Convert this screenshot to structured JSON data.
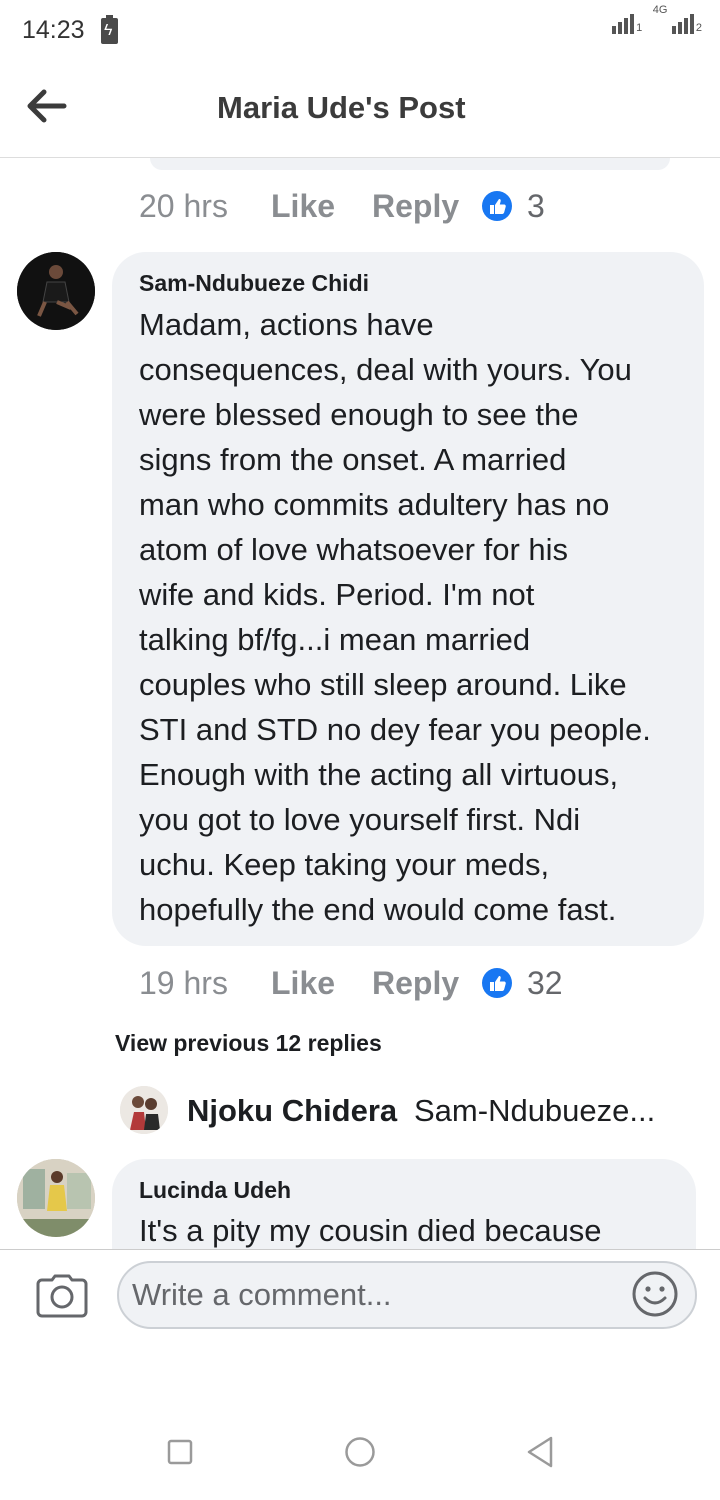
{
  "status_bar": {
    "time": "14:23",
    "network": "4G",
    "sim1": "1",
    "sim2": "2"
  },
  "header": {
    "title": "Maria Ude's Post"
  },
  "prev_comment_actions": {
    "time": "20 hrs",
    "like_label": "Like",
    "reply_label": "Reply",
    "reaction_count": "3"
  },
  "comments": [
    {
      "author": "Sam-Ndubueze Chidi",
      "lines": [
        "Madam, actions have",
        "consequences, deal with yours. You",
        "were blessed enough to see the",
        "signs from the onset. A married",
        "man who commits adultery has no",
        "atom of love whatsoever for his",
        "wife and kids. Period. I'm not",
        "talking bf/fg...i mean married",
        "couples who still sleep around. Like",
        "STI and STD no dey fear you people.",
        "Enough with the acting all virtuous,",
        "you got to love yourself first. Ndi",
        "uchu. Keep taking your meds,",
        "hopefully the end would come fast."
      ],
      "time": "19 hrs",
      "like_label": "Like",
      "reply_label": "Reply",
      "reaction_count": "32",
      "view_previous": "View previous 12 replies",
      "latest_reply": {
        "author": "Njoku Chidera",
        "preview": "Sam-Ndubueze..."
      }
    },
    {
      "author": "Lucinda Udeh",
      "lines": [
        "It's a pity my cousin died because"
      ]
    }
  ],
  "composer": {
    "placeholder": "Write a comment..."
  },
  "icons": {
    "back": "arrow-left-icon",
    "camera": "camera-icon",
    "emoji": "smiley-icon",
    "like": "thumbs-up-icon",
    "nav": [
      "square-recents-icon",
      "circle-home-icon",
      "triangle-back-icon"
    ]
  },
  "colors": {
    "facebook_blue": "#1877f2",
    "bubble_bg": "#f0f2f5",
    "muted_text": "#8a8d91"
  }
}
